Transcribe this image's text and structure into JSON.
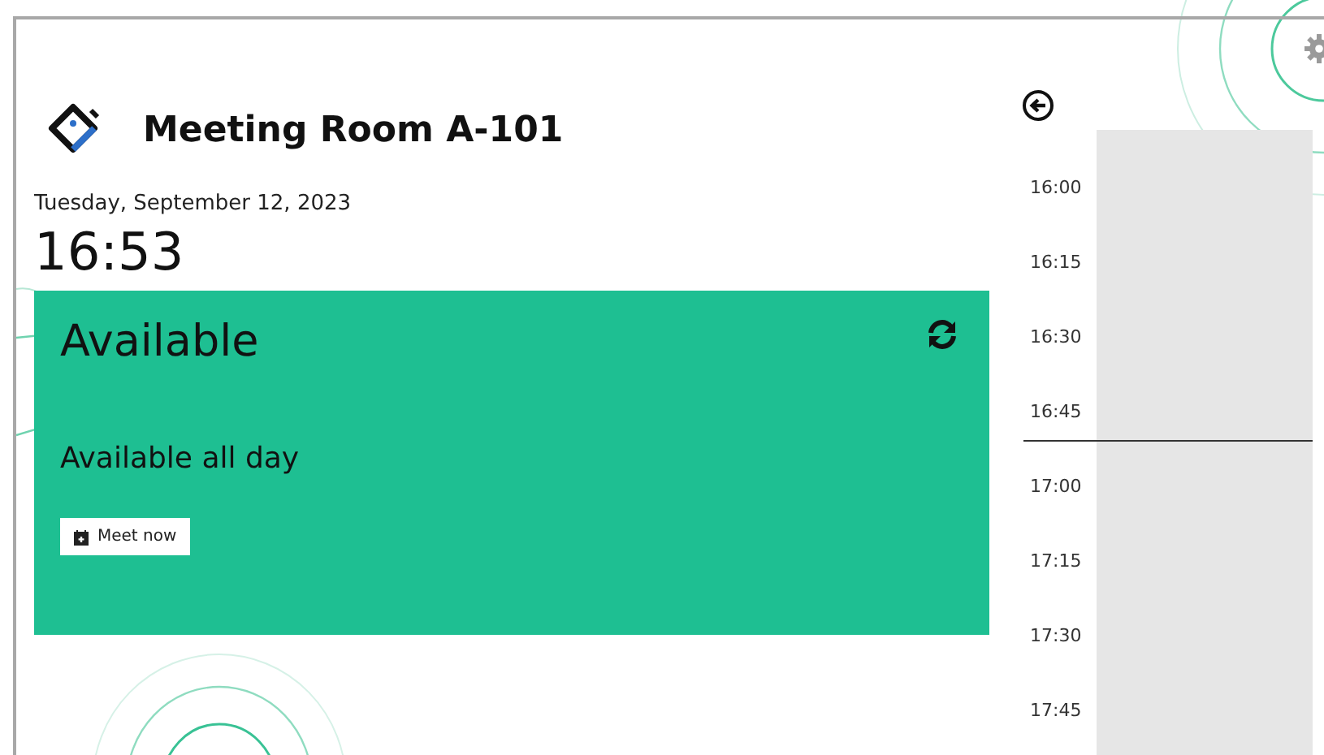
{
  "room": {
    "name": "Meeting Room A-101",
    "date": "Tuesday, September 12, 2023",
    "time": "16:53"
  },
  "status": {
    "kind": "available",
    "title": "Available",
    "message": "Available all day",
    "button": "Meet now"
  },
  "schedule": [
    {
      "time": "16:00",
      "current": false
    },
    {
      "time": "16:15",
      "current": false
    },
    {
      "time": "16:30",
      "current": false
    },
    {
      "time": "16:45",
      "current": true
    },
    {
      "time": "17:00",
      "current": false
    },
    {
      "time": "17:15",
      "current": false
    },
    {
      "time": "17:30",
      "current": false
    },
    {
      "time": "17:45",
      "current": false
    }
  ]
}
